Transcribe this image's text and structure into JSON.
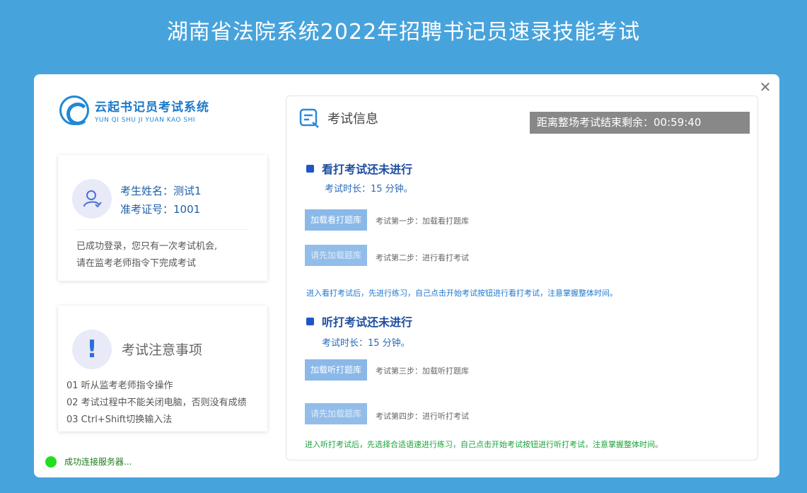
{
  "header": {
    "title": "湖南省法院系统2022年招聘书记员速录技能考试"
  },
  "logo": {
    "name_cn": "云起书记员考试系统",
    "name_en": "YUN QI SHU JI YUAN KAO SHI"
  },
  "user": {
    "name_line": "考生姓名：测试1",
    "id_line": "准考证号：1001",
    "message_line1": "已成功登录，您只有一次考试机会,",
    "message_line2": "请在监考老师指令下完成考试"
  },
  "notice": {
    "title": "考试注意事项",
    "items": [
      "01 听从监考老师指令操作",
      "02 考试过程中不能关闭电脑，否则没有成绩",
      "03 Ctrl+Shift切换输入法"
    ]
  },
  "status": {
    "text": "成功连接服务器..."
  },
  "exam": {
    "title": "考试信息",
    "timer": "距离整场考试结束剩余：00:59:40",
    "reading": {
      "title": "看打考试还未进行",
      "duration": "考试时长：15 分钟。",
      "load_button": "加载看打题库",
      "step1": "考试第一步：加载看打题库",
      "start_button": "请先加载题库",
      "step2": "考试第二步：进行看打考试",
      "hint": "进入看打考试后，先进行练习，自己点击开始考试按钮进行看打考试，注意掌握整体时间。"
    },
    "listening": {
      "title": "听打考试还未进行",
      "duration": "考试时长：15 分钟。",
      "load_button": "加载听打题库",
      "step3": "考试第三步：加载听打题库",
      "start_button": "请先加载题库",
      "step4": "考试第四步：进行听打考试",
      "hint": "进入听打考试后，先选择合适语速进行练习，自己点击开始考试按钮进行听打考试，注意掌握整体时间。"
    }
  },
  "colors": {
    "background": "#47a3dc",
    "accent": "#1e56c8",
    "timer_bg": "#888888",
    "status_dot": "#22dd22"
  }
}
